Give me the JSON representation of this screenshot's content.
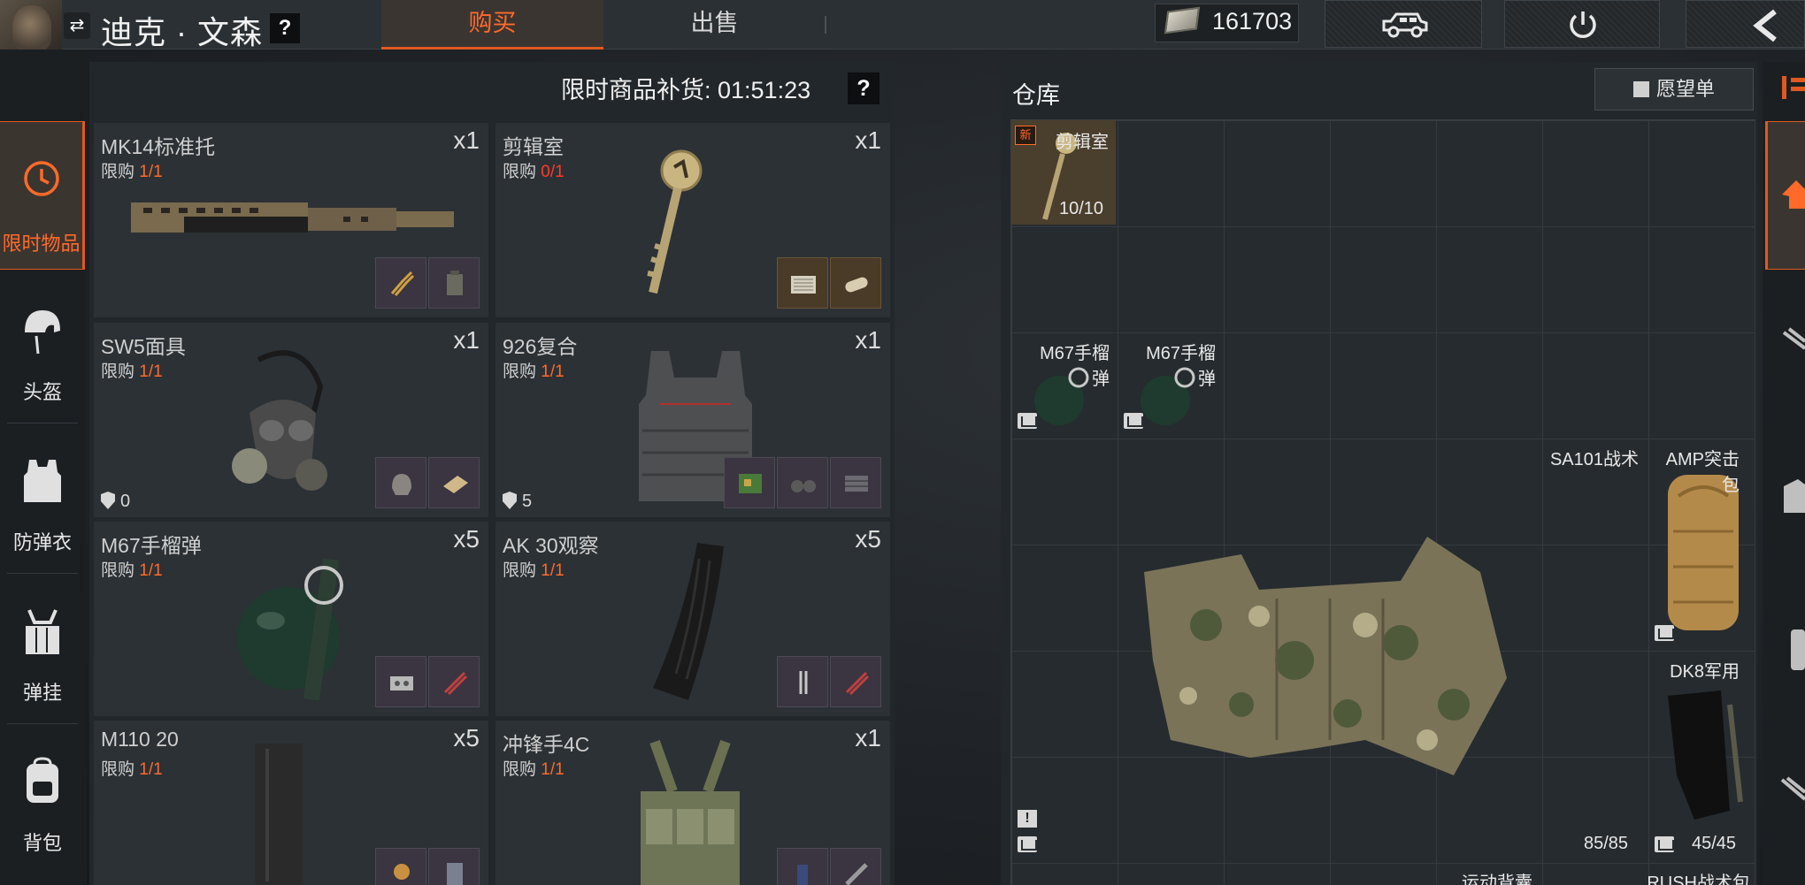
{
  "header": {
    "player_name": "迪克 · 文森",
    "help_glyph": "?",
    "tabs": [
      {
        "label": "购买",
        "active": true
      },
      {
        "label": "出售",
        "active": false
      }
    ],
    "currency": "161703",
    "accent_color": "#e0591f"
  },
  "categories": [
    {
      "label": "限时物品",
      "icon": "clock-icon",
      "active": true
    },
    {
      "label": "头盔",
      "icon": "helmet-icon",
      "active": false
    },
    {
      "label": "防弹衣",
      "icon": "vest-icon",
      "active": false
    },
    {
      "label": "弹挂",
      "icon": "chest-rig-icon",
      "active": false
    },
    {
      "label": "背包",
      "icon": "backpack-icon",
      "active": false
    }
  ],
  "shop": {
    "restock_label": "限时商品补货: 01:51:23",
    "help_glyph": "?",
    "items": [
      {
        "name": "MK14标准托",
        "qty": "x1",
        "limit_label": "限购",
        "limit_value": "1/1",
        "armor": null
      },
      {
        "name": "剪辑室",
        "qty": "x1",
        "limit_label": "限购",
        "limit_value": "0/1",
        "armor": null
      },
      {
        "name": "SW5面具",
        "qty": "x1",
        "limit_label": "限购",
        "limit_value": "1/1",
        "armor": "0"
      },
      {
        "name": "926复合",
        "qty": "x1",
        "limit_label": "限购",
        "limit_value": "1/1",
        "armor": "5"
      },
      {
        "name": "M67手榴弹",
        "qty": "x5",
        "limit_label": "限购",
        "limit_value": "1/1",
        "armor": null
      },
      {
        "name": "AK 30观察",
        "qty": "x5",
        "limit_label": "限购",
        "limit_value": "1/1",
        "armor": null
      },
      {
        "name": "M110 20",
        "qty": "x5",
        "limit_label": "限购",
        "limit_value": "1/1",
        "armor": null
      },
      {
        "name": "冲锋手4C",
        "qty": "x1",
        "limit_label": "限购",
        "limit_value": "1/1",
        "armor": null
      }
    ]
  },
  "stash": {
    "title": "仓库",
    "wishlist_label": "愿望单",
    "new_badge": "新",
    "items": [
      {
        "name": "剪辑室",
        "count": "10/10"
      },
      {
        "name_line1": "M67手榴",
        "name_line2": "弹"
      },
      {
        "name_line1": "M67手榴",
        "name_line2": "弹"
      },
      {
        "name": "SA101战术",
        "count": "85/85"
      },
      {
        "name_line1": "AMP突击",
        "name_line2": "包"
      },
      {
        "name": "DK8军用",
        "count": "45/45"
      },
      {
        "name": "运动背囊"
      },
      {
        "name": "RUSH战术包"
      }
    ]
  }
}
